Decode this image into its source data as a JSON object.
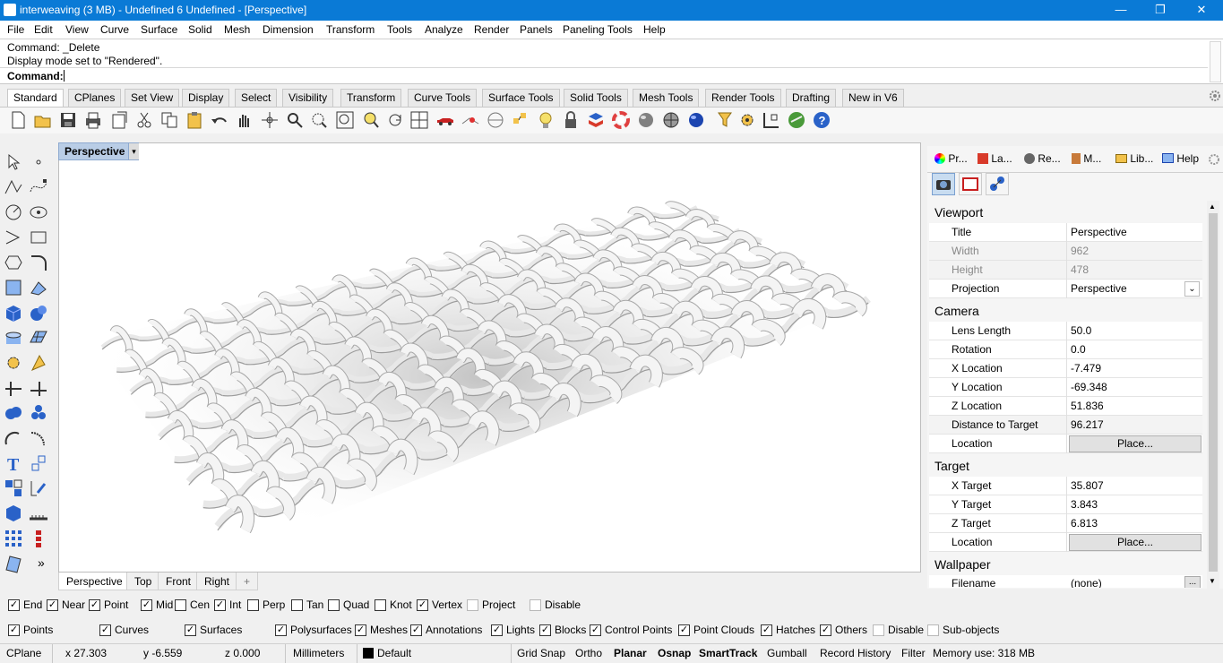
{
  "window": {
    "title": "interweaving (3 MB) - Undefined 6 Undefined - [Perspective]",
    "minimize": "—",
    "maximize": "❐",
    "close": "✕"
  },
  "menu": [
    "File",
    "Edit",
    "View",
    "Curve",
    "Surface",
    "Solid",
    "Mesh",
    "Dimension",
    "Transform",
    "Tools",
    "Analyze",
    "Render",
    "Panels",
    "Paneling Tools",
    "Help"
  ],
  "command": {
    "line1": "Command: _Delete",
    "line2": "Display mode set to \"Rendered\".",
    "prompt": "Command:"
  },
  "toolbar_tabs": [
    "Standard",
    "CPlanes",
    "Set View",
    "Display",
    "Select",
    "Visibility",
    "Transform",
    "Curve Tools",
    "Surface Tools",
    "Solid Tools",
    "Mesh Tools",
    "Render Tools",
    "Drafting",
    "New in V6"
  ],
  "toolbar_icons": [
    "new-icon",
    "open-icon",
    "save-icon",
    "print-icon",
    "import-icon",
    "cut-icon",
    "copy-icon",
    "paste-icon",
    "undo-icon",
    "pan-icon",
    "rotate-view-icon",
    "zoom-icon",
    "zoom-window-icon",
    "zoom-extents-icon",
    "zoom-selected-icon",
    "rotate-icon",
    "four-viewports-icon",
    "car-icon",
    "camera-icon",
    "cplane-icon",
    "points-icon",
    "light-icon",
    "lock-icon",
    "layers-icon",
    "color-icon",
    "material-icon",
    "render-icon",
    "render-sphere-icon",
    "filter-icon",
    "settings-icon",
    "snap-icon",
    "globe-icon",
    "help-icon"
  ],
  "viewport": {
    "name": "Perspective",
    "tabs": [
      "Perspective",
      "Top",
      "Front",
      "Right"
    ],
    "add": "+"
  },
  "panel_tabs": [
    "Pr...",
    "La...",
    "Re...",
    "M...",
    "Lib...",
    "Help"
  ],
  "properties": {
    "viewport_section": "Viewport",
    "title_label": "Title",
    "title_value": "Perspective",
    "width_label": "Width",
    "width_value": "962",
    "height_label": "Height",
    "height_value": "478",
    "projection_label": "Projection",
    "projection_value": "Perspective",
    "camera_section": "Camera",
    "lens_label": "Lens Length",
    "lens_value": "50.0",
    "rotation_label": "Rotation",
    "rotation_value": "0.0",
    "xloc_label": "X Location",
    "xloc_value": "-7.479",
    "yloc_label": "Y Location",
    "yloc_value": "-69.348",
    "zloc_label": "Z Location",
    "zloc_value": "51.836",
    "dist_label": "Distance to Target",
    "dist_value": "96.217",
    "location_label": "Location",
    "place_button": "Place...",
    "target_section": "Target",
    "xtarget_label": "X Target",
    "xtarget_value": "35.807",
    "ytarget_label": "Y Target",
    "ytarget_value": "3.843",
    "ztarget_label": "Z Target",
    "ztarget_value": "6.813",
    "target_location_label": "Location",
    "target_place_button": "Place...",
    "wallpaper_section": "Wallpaper",
    "filename_label": "Filename",
    "filename_value": "(none)",
    "browse": "..."
  },
  "osnaps": [
    {
      "label": "End",
      "checked": true
    },
    {
      "label": "Near",
      "checked": true
    },
    {
      "label": "Point",
      "checked": true
    },
    {
      "label": "Mid",
      "checked": true
    },
    {
      "label": "Cen",
      "checked": false
    },
    {
      "label": "Int",
      "checked": true
    },
    {
      "label": "Perp",
      "checked": false
    },
    {
      "label": "Tan",
      "checked": false
    },
    {
      "label": "Quad",
      "checked": false
    },
    {
      "label": "Knot",
      "checked": false
    },
    {
      "label": "Vertex",
      "checked": true
    },
    {
      "label": "Project",
      "checked": false
    },
    {
      "label": "Disable",
      "checked": false
    }
  ],
  "filters": [
    {
      "label": "Points",
      "checked": true
    },
    {
      "label": "Curves",
      "checked": true
    },
    {
      "label": "Surfaces",
      "checked": true
    },
    {
      "label": "Polysurfaces",
      "checked": true
    },
    {
      "label": "Meshes",
      "checked": true
    },
    {
      "label": "Annotations",
      "checked": true
    },
    {
      "label": "Lights",
      "checked": true
    },
    {
      "label": "Blocks",
      "checked": true
    },
    {
      "label": "Control Points",
      "checked": true
    },
    {
      "label": "Point Clouds",
      "checked": true
    },
    {
      "label": "Hatches",
      "checked": true
    },
    {
      "label": "Others",
      "checked": true
    },
    {
      "label": "Disable",
      "checked": false
    },
    {
      "label": "Sub-objects",
      "checked": false
    }
  ],
  "status": {
    "cplane": "CPlane",
    "x": "x 27.303",
    "y": "y -6.559",
    "z": "z 0.000",
    "units": "Millimeters",
    "layer": "Default",
    "grid_snap": "Grid Snap",
    "ortho": "Ortho",
    "planar": "Planar",
    "osnap": "Osnap",
    "smarttrack": "SmartTrack",
    "gumball": "Gumball",
    "record_history": "Record History",
    "filter": "Filter",
    "memory": "Memory use: 318 MB"
  },
  "colors": {
    "titlebar": "#0a7ad6",
    "viewport_label": "#b9cde6",
    "weave": "#e8e8e8"
  }
}
